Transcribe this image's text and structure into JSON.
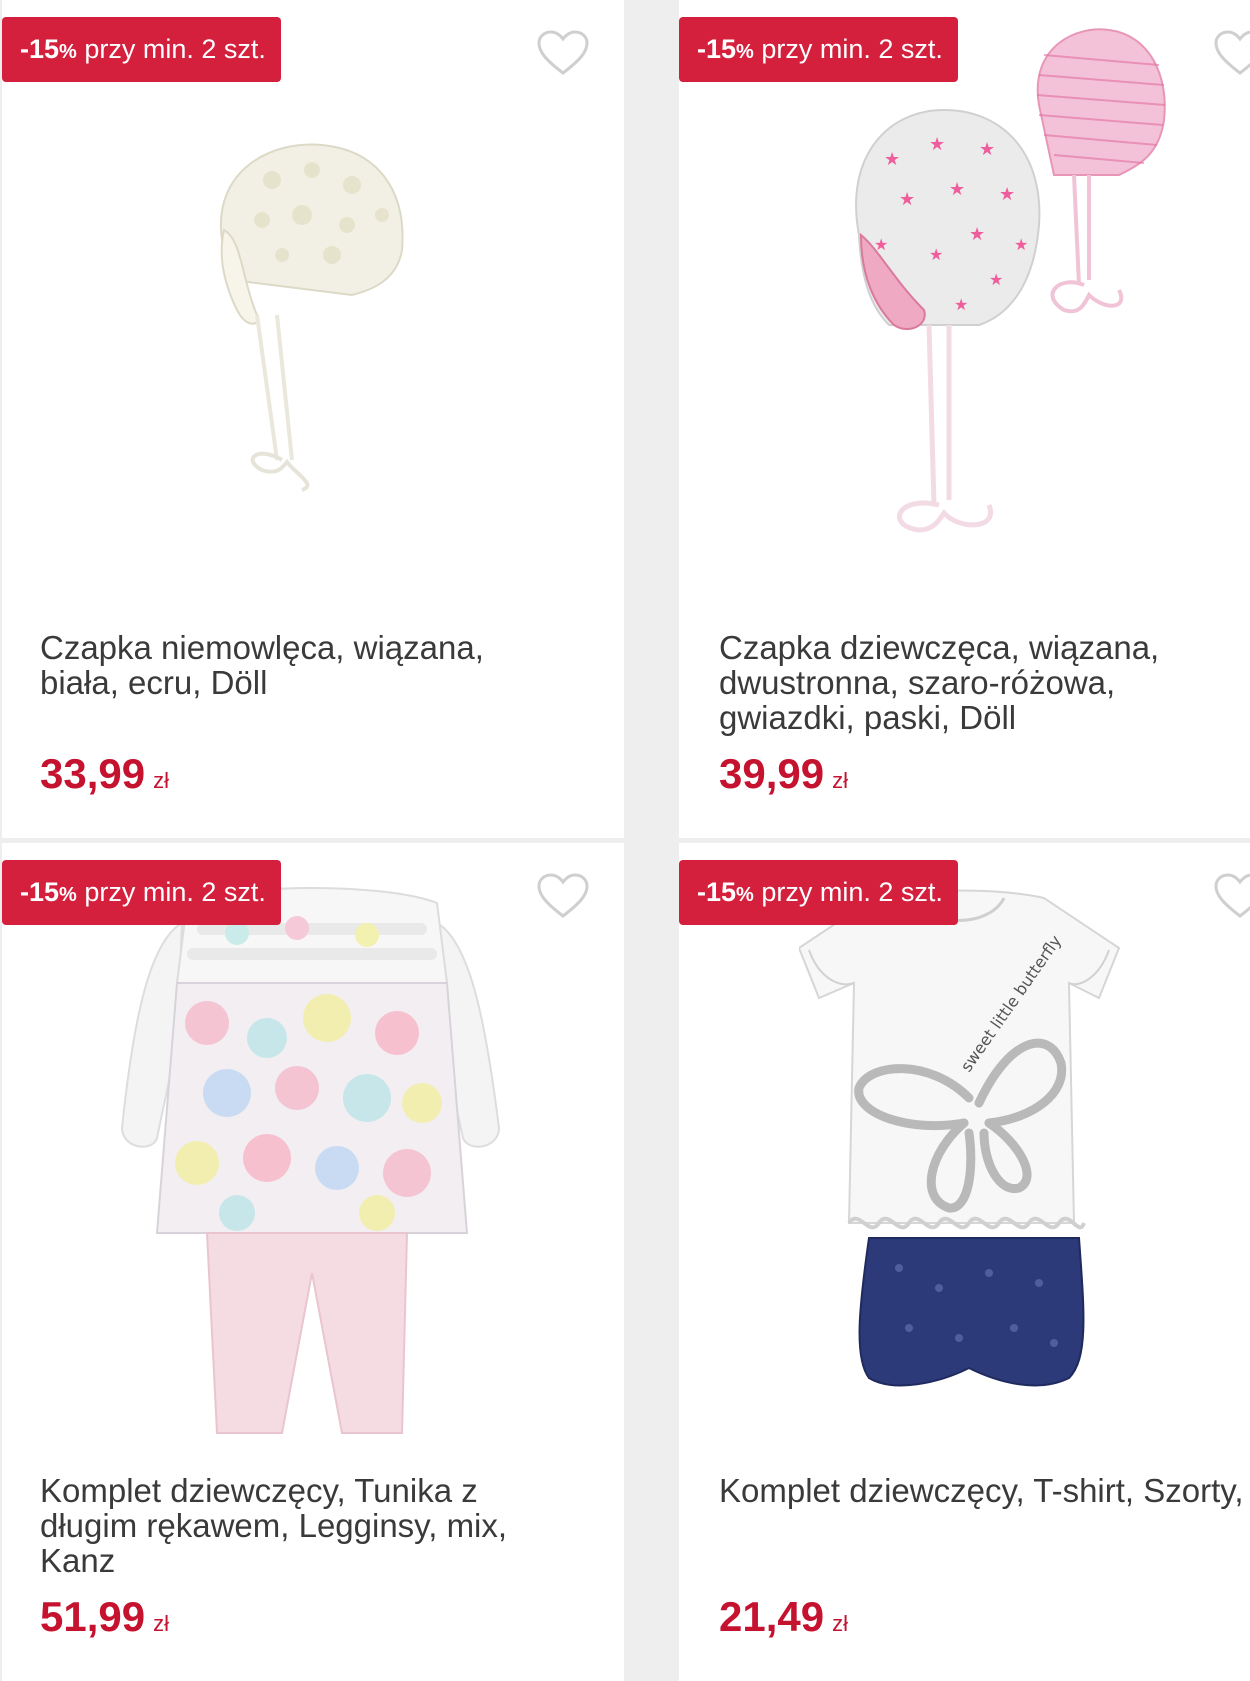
{
  "products": [
    {
      "badge": {
        "discount": "-15",
        "percent": "%",
        "text": " przy min. 2 szt."
      },
      "title": "Czapka niemowlęca, wiązana, biała, ecru, Döll",
      "price": "33,99",
      "currency": "zł",
      "image_icon": "baby-bonnet-white"
    },
    {
      "badge": {
        "discount": "-15",
        "percent": "%",
        "text": " przy min. 2 szt."
      },
      "title": "Czapka dziewczęca, wiązana, dwustronna, szaro-różowa, gwiazdki, paski, Döll",
      "price": "39,99",
      "currency": "zł",
      "image_icon": "baby-bonnet-pink-stars"
    },
    {
      "badge": {
        "discount": "-15",
        "percent": "%",
        "text": " przy min. 2 szt."
      },
      "title": "Komplet dziewczęcy, Tunika z długim rękawem, Legginsy, mix, Kanz",
      "price": "51,99",
      "currency": "zł",
      "image_icon": "tunic-leggings-set"
    },
    {
      "badge": {
        "discount": "-15",
        "percent": "%",
        "text": " przy min. 2 szt."
      },
      "title": "Komplet dziewczęcy, T-shirt, Szorty, mix, Kanz",
      "price": "21,49",
      "currency": "zł",
      "image_icon": "tshirt-shorts-set"
    }
  ],
  "colors": {
    "accent": "#d41f3d",
    "price": "#c4122f",
    "background": "#eeeeee"
  }
}
